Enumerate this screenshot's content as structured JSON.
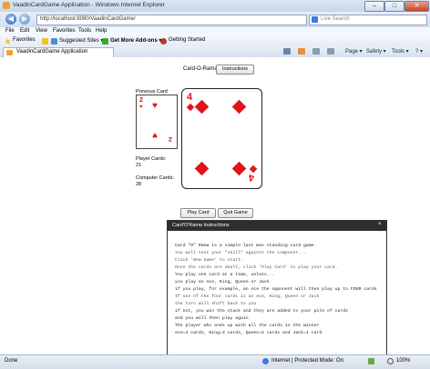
{
  "window": {
    "title": "VaadinCardGame Application - Windows Internet Explorer",
    "buttons": {
      "minimize": "–",
      "maximize": "□",
      "close": "✕"
    }
  },
  "addressbar": {
    "url": "http://localhost:8080/VaadinCardGame/",
    "search_placeholder": "Live Search",
    "back_glyph": "◀",
    "forward_glyph": "▶"
  },
  "menu": [
    "File",
    "Edit",
    "View",
    "Favorites",
    "Tools",
    "Help"
  ],
  "favorites": {
    "favorites_label": "Favorites",
    "suggested_sites": "Suggested Sites ▾",
    "addons": "Get More Add-ons ▾",
    "getting_started": "Getting Started"
  },
  "tab": {
    "label": "VaadinCardGame Application"
  },
  "commands": {
    "page": "Page ▾",
    "safety": "Safety ▾",
    "tools": "Tools ▾",
    "help": "? ▾"
  },
  "game": {
    "title": "Card-O-Rama",
    "instructions_button": "Instructions",
    "previous_card_label": "Previous Card",
    "previous_card_rank": "2",
    "main_card_rank": "4",
    "player_cards_label": "Player Cards:",
    "player_cards_count": "21",
    "computer_cards_label": "Computer Cards:",
    "computer_cards_count": "28",
    "play_button": "Play Card",
    "quit_button": "Quit Game",
    "suit_color": "#e0141b"
  },
  "dialog": {
    "title": "Card'O'Rama Instructions",
    "close": "×",
    "lines": [
      "Card \"O\" Rama is a simple last man standing card game.",
      "You will test your \"skill\" against the computer...",
      "Click 'New Game' to start.",
      "Once the cards are dealt, click 'Play Card' to play your card.",
      "You play one card at a time, unless...",
      "you play an Ace, King, Queen or Jack",
      "if you play, for example, an Ace the opponent will then play up to FOUR cards",
      "If one of the four cards is an Ace, King, Queen or Jack",
      "the turn will shift back to you",
      "if not, you win the stack and they are added to your pile of cards",
      "and you will then play again",
      "The player who ends up with all the cards is the winner",
      " Ace=4 cards, King=3 cards, Queen=2 cards and Jack=1 card"
    ]
  },
  "status": {
    "left": "Done",
    "zone": "Internet | Protected Mode: On",
    "zoom": "100%"
  }
}
